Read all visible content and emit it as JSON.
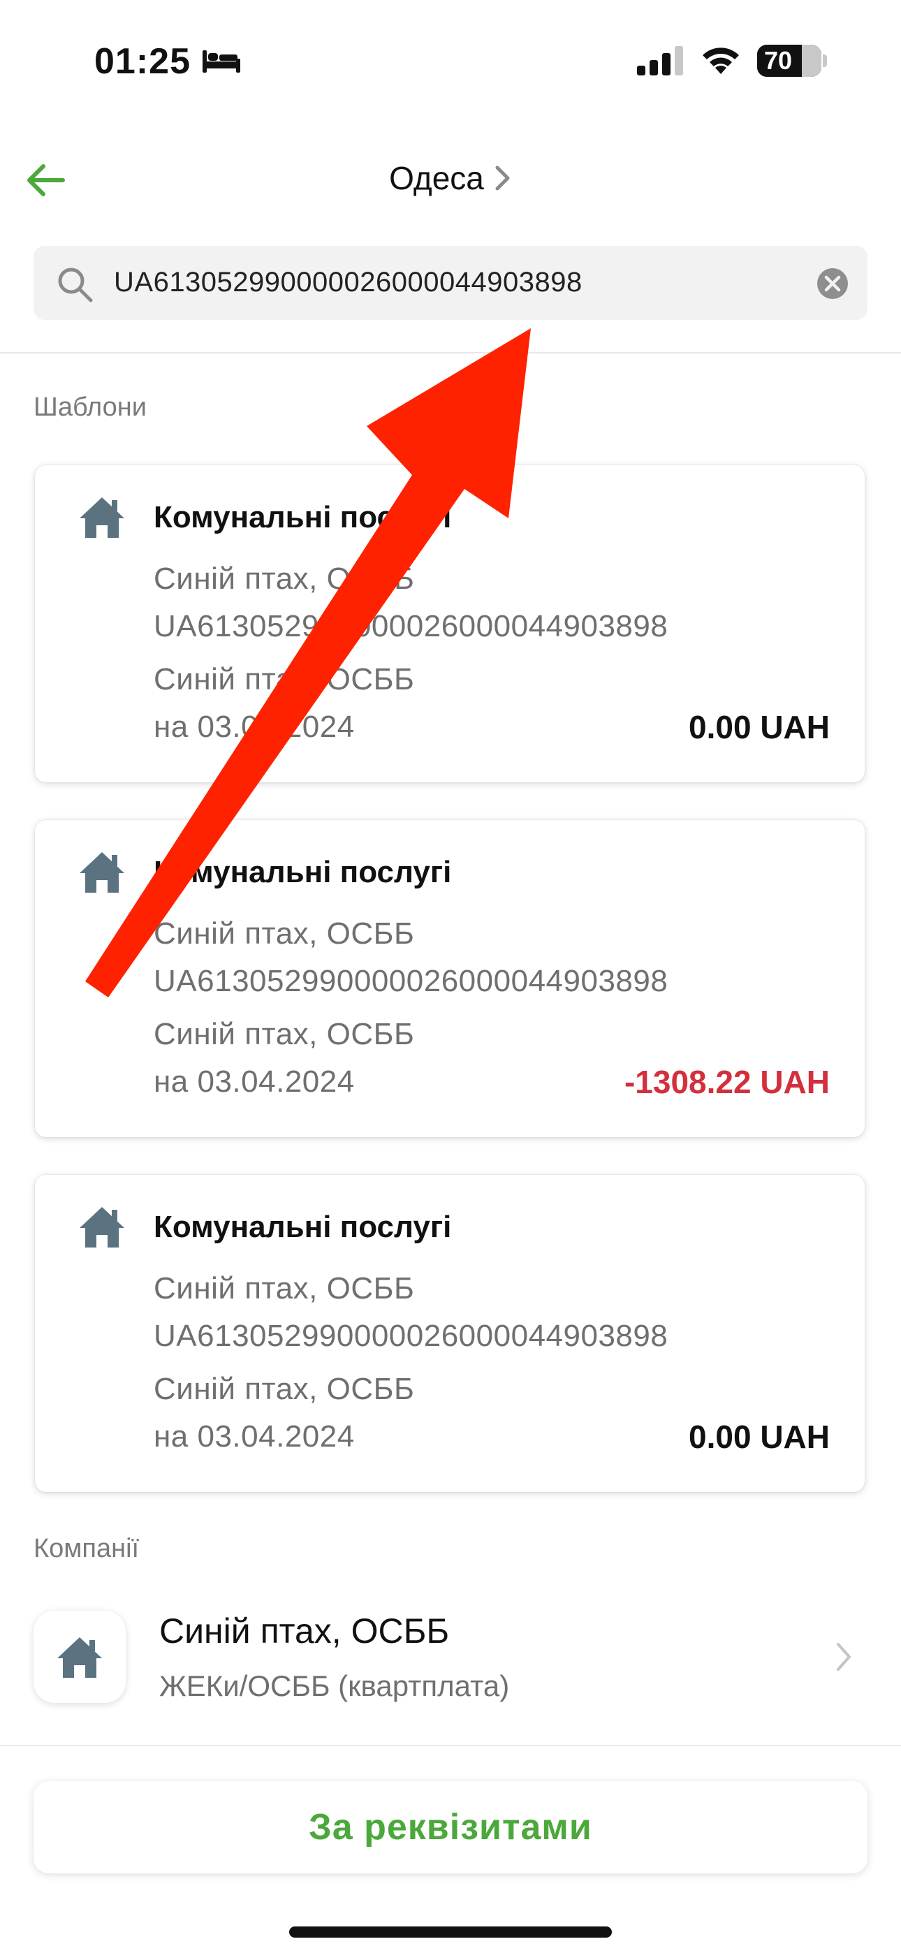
{
  "status_bar": {
    "time": "01:25",
    "battery_level": "70"
  },
  "header": {
    "title": "Одеса"
  },
  "search": {
    "value": "UA613052990000026000044903898"
  },
  "templates_section": {
    "label": "Шаблони",
    "items": [
      {
        "title": "Комунальні послугі",
        "recipient": "Синій птах, ОСББ",
        "iban": "UA613052990000026000044903898",
        "company": "Синій птах, ОСББ",
        "date": "на 03.04.2024",
        "amount": "0.00 UAH",
        "amount_color": "#111111"
      },
      {
        "title": "Комунальні послугі",
        "recipient": "Синій птах, ОСББ",
        "iban": "UA613052990000026000044903898",
        "company": "Синій птах, ОСББ",
        "date": "на 03.04.2024",
        "amount": "-1308.22 UAH",
        "amount_color": "#d32f3c"
      },
      {
        "title": "Комунальні послугі",
        "recipient": "Синій птах, ОСББ",
        "iban": "UA613052990000026000044903898",
        "company": "Синій птах, ОСББ",
        "date": "на 03.04.2024",
        "amount": "0.00 UAH",
        "amount_color": "#111111"
      }
    ]
  },
  "companies_section": {
    "label": "Компанії",
    "items": [
      {
        "name": "Синій птах, ОСББ",
        "category": "ЖЕКи/ОСББ (квартплата)"
      }
    ]
  },
  "bottom_button": {
    "label": "За реквізитами"
  },
  "colors": {
    "accent_green": "#4ba83a",
    "negative_red": "#d32f3c",
    "icon_slate": "#5b7281",
    "annotation_red": "#ff2200"
  },
  "icons": [
    "bed-icon",
    "signal-icon",
    "wifi-icon",
    "back-arrow-icon",
    "chevron-right-icon",
    "search-icon",
    "clear-icon",
    "home-icon"
  ]
}
